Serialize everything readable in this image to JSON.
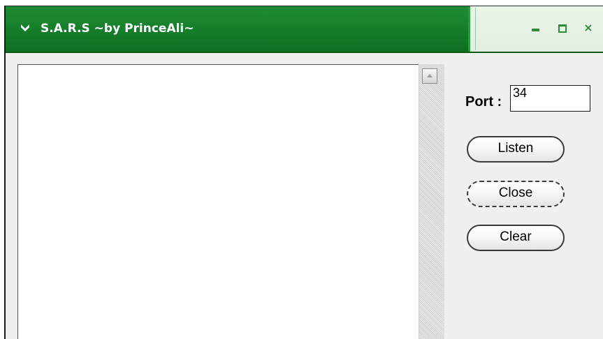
{
  "window": {
    "title": "S.A.R.S ~by PrinceAli~",
    "icon": "arrow-icon",
    "controls": {
      "minimize": "minimize-icon",
      "maximize": "maximize-icon",
      "close_glyph": "×"
    }
  },
  "log": {
    "text": ""
  },
  "port": {
    "label": "Port :",
    "value": "34"
  },
  "buttons": {
    "listen": "Listen",
    "close": "Close",
    "clear": "Clear"
  },
  "colors": {
    "titlebar": "#17802c",
    "accent": "#2f8a3a"
  }
}
